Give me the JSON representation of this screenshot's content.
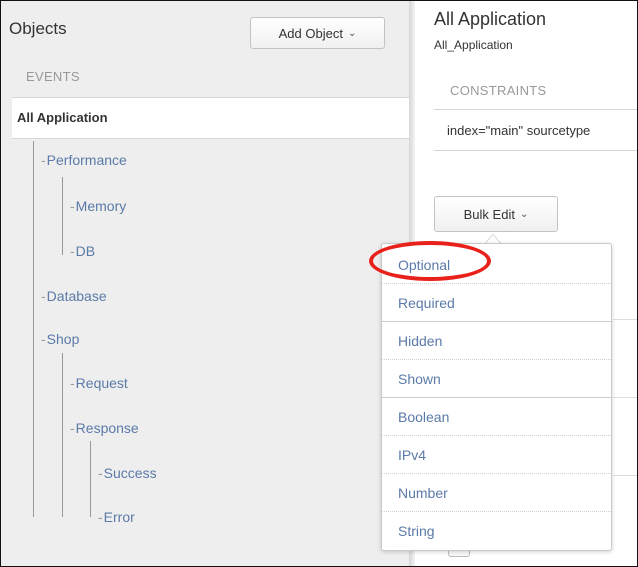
{
  "objects_panel": {
    "title": "Objects",
    "add_object_button": "Add Object",
    "section_label": "EVENTS",
    "selected_item": "All Application",
    "tree": [
      {
        "label": "Performance",
        "depth": 1
      },
      {
        "label": "Memory",
        "depth": 2
      },
      {
        "label": "DB",
        "depth": 2
      },
      {
        "label": "Database",
        "depth": 1
      },
      {
        "label": "Shop",
        "depth": 1
      },
      {
        "label": "Request",
        "depth": 2
      },
      {
        "label": "Response",
        "depth": 2
      },
      {
        "label": "Success",
        "depth": 3
      },
      {
        "label": "Error",
        "depth": 3
      }
    ]
  },
  "detail_panel": {
    "title": "All Application",
    "subtitle": "All_Application",
    "constraints_label": "CONSTRAINTS",
    "constraints_text": "index=\"main\" sourcetype",
    "bulk_edit_button": "Bulk Edit"
  },
  "bulk_edit_menu": {
    "items": [
      "Optional",
      "Required",
      "Hidden",
      "Shown",
      "Boolean",
      "IPv4",
      "Number",
      "String"
    ],
    "highlighted_item": "Optional"
  },
  "colors": {
    "link": "#5b7aa8",
    "panel_background": "#eeeeee",
    "highlight": "#e8211b",
    "muted_text": "#999999"
  },
  "icons": {
    "dropdown_chevron": "chevron-down-icon"
  }
}
